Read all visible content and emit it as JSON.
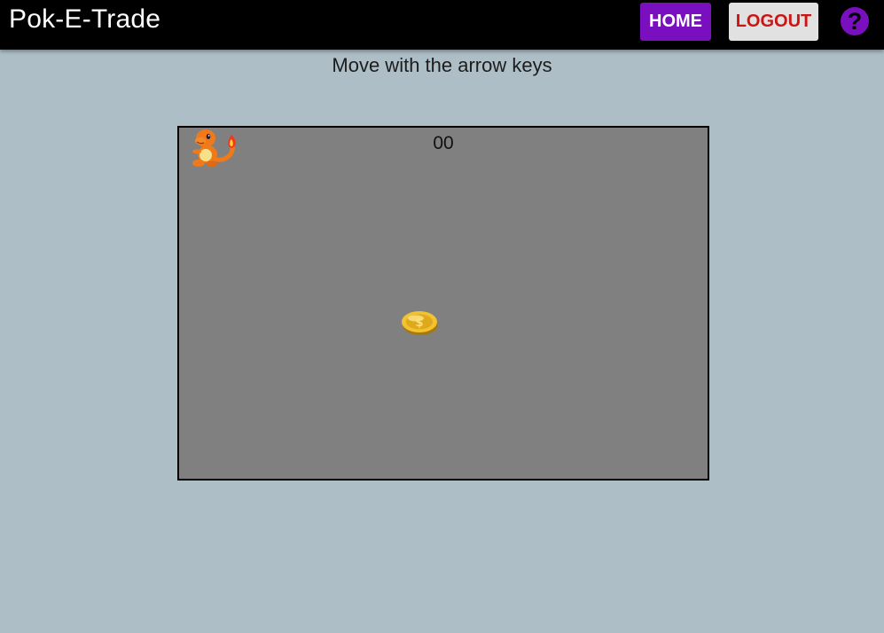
{
  "header": {
    "brand": "Pok-E-Trade",
    "home_label": "HOME",
    "logout_label": "LOGOUT",
    "help_label": "?"
  },
  "main": {
    "instructions": "Move with the arrow keys"
  },
  "game": {
    "score": "00",
    "player_icon": "charmander-sprite",
    "coin_icon": "gold-coin-icon"
  },
  "colors": {
    "navbar": "#000000",
    "accent": "#7a0fbf",
    "logout_text": "#cc1414",
    "page_background": "#adbec6",
    "game_background": "#808080"
  }
}
